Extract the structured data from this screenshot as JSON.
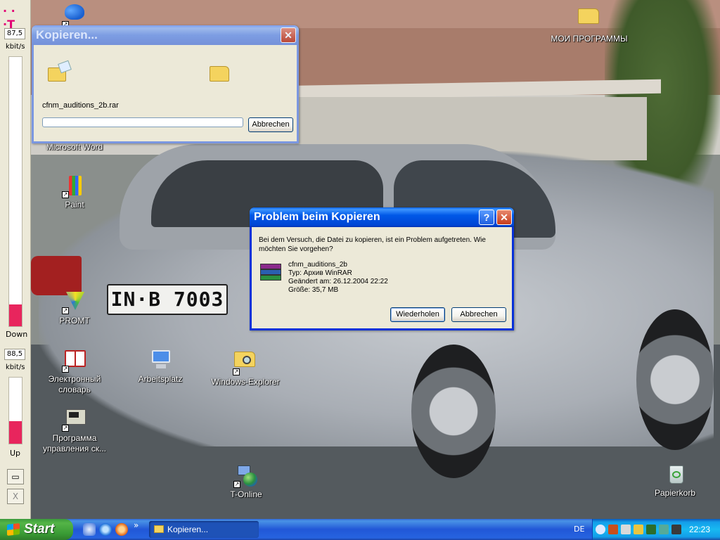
{
  "meter": {
    "logo": "· · ·T",
    "down_value": "87,5",
    "down_unit": "kbit/s",
    "down_label": "Down",
    "down_level": 0.08,
    "up_value": "88,5",
    "up_unit": "kbit/s",
    "up_label": "Up",
    "up_level": 0.34,
    "btn1": "▭",
    "btn2": "X",
    "fill_color": "#e8255d"
  },
  "desktop_icons": {
    "word": "Microsoft Word",
    "paint": "Paint",
    "promt": "PROMT",
    "dictionary_line1": "Электронный",
    "dictionary_line2": "словарь",
    "arbeitsplatz": "Arbeitsplatz",
    "explorer": "Windows-Explorer",
    "programm_line1": "Программа",
    "programm_line2": "управления ск...",
    "tonline": "T-Online",
    "moi": "МОИ ПРОГРАММЫ",
    "papierkorb": "Papierkorb"
  },
  "wallpaper": {
    "plate": "IN·B 7003"
  },
  "copy_window": {
    "title": "Kopieren...",
    "filename": "cfnm_auditions_2b.rar",
    "progress": 0.0,
    "cancel_label": "Abbrechen",
    "close_glyph": "✕"
  },
  "problem_dialog": {
    "title": "Problem beim Kopieren",
    "message": "Bei dem Versuch, die Datei zu kopieren, ist ein Problem aufgetreten. Wie möchten Sie vorgehen?",
    "file_name": "cfnm_auditions_2b",
    "file_type": "Typ: Архив WinRAR",
    "file_modified": "Geändert am: 26.12.2004 22:22",
    "file_size": "Größe: 35,7 MB",
    "retry_label": "Wiederholen",
    "cancel_label": "Abbrechen",
    "help_glyph": "?",
    "close_glyph": "✕"
  },
  "taskbar": {
    "start_label": "Start",
    "chevron": "»",
    "task_label": "Kopieren...",
    "lang": "DE",
    "clock": "22:23"
  },
  "colors": {
    "title_active": "#0058e7",
    "title_inactive": "#7d9de3",
    "start_green": "#3a9b35"
  }
}
